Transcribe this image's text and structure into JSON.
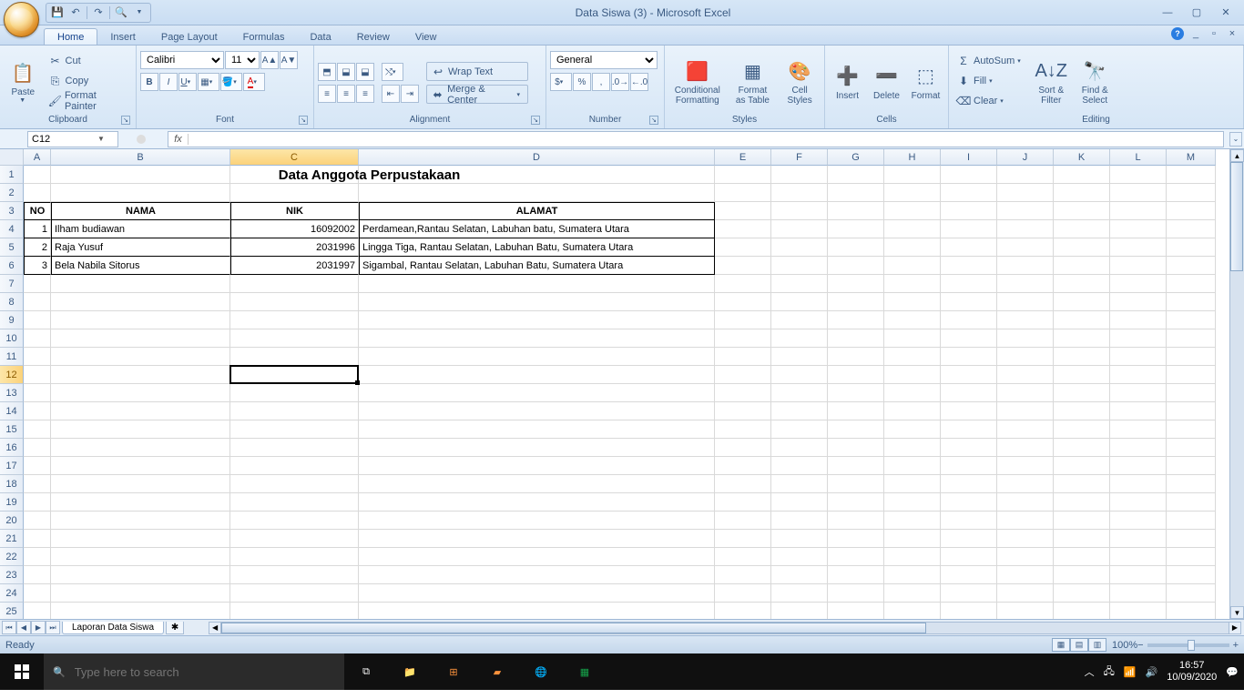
{
  "app": {
    "title": "Data Siswa (3) - Microsoft Excel"
  },
  "tabs": [
    "Home",
    "Insert",
    "Page Layout",
    "Formulas",
    "Data",
    "Review",
    "View"
  ],
  "active_tab": "Home",
  "ribbon": {
    "clipboard": {
      "label": "Clipboard",
      "paste": "Paste",
      "cut": "Cut",
      "copy": "Copy",
      "format_painter": "Format Painter"
    },
    "font": {
      "label": "Font",
      "name": "Calibri",
      "size": "11"
    },
    "alignment": {
      "label": "Alignment",
      "wrap": "Wrap Text",
      "merge": "Merge & Center"
    },
    "number": {
      "label": "Number",
      "format": "General"
    },
    "styles": {
      "label": "Styles",
      "cond": "Conditional\nFormatting",
      "table": "Format\nas Table",
      "cell": "Cell\nStyles"
    },
    "cells": {
      "label": "Cells",
      "insert": "Insert",
      "delete": "Delete",
      "format": "Format"
    },
    "editing": {
      "label": "Editing",
      "autosum": "AutoSum",
      "fill": "Fill",
      "clear": "Clear",
      "sort": "Sort &\nFilter",
      "find": "Find &\nSelect"
    }
  },
  "namebox": "C12",
  "columns": [
    "A",
    "B",
    "C",
    "D",
    "E",
    "F",
    "G",
    "H",
    "I",
    "J",
    "K",
    "L",
    "M"
  ],
  "selected_col": "C",
  "selected_row": 12,
  "sheet": {
    "title": "Data Anggota Perpustakaan",
    "headers": {
      "no": "NO",
      "nama": "NAMA",
      "nik": "NIK",
      "alamat": "ALAMAT"
    },
    "rows": [
      {
        "no": "1",
        "nama": "Ilham budiawan",
        "nik": "16092002",
        "alamat": "Perdamean,Rantau Selatan, Labuhan batu, Sumatera Utara"
      },
      {
        "no": "2",
        "nama": "Raja Yusuf",
        "nik": "2031996",
        "alamat": "Lingga Tiga, Rantau Selatan, Labuhan Batu, Sumatera Utara"
      },
      {
        "no": "3",
        "nama": "Bela Nabila Sitorus",
        "nik": "2031997",
        "alamat": "Sigambal, Rantau Selatan, Labuhan Batu, Sumatera Utara"
      }
    ]
  },
  "sheet_tab": "Laporan Data Siswa",
  "status": {
    "ready": "Ready",
    "zoom": "100%"
  },
  "taskbar": {
    "search_placeholder": "Type here to search",
    "time": "16:57",
    "date": "10/09/2020"
  }
}
